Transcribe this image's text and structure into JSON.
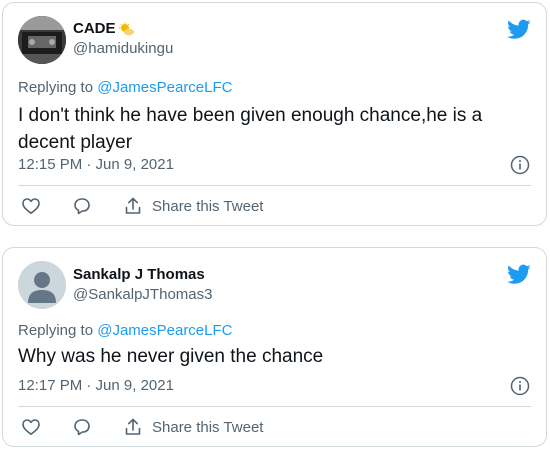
{
  "tweets": [
    {
      "display_name": "CADE",
      "name_emoji": "sun-behind-cloud-icon",
      "handle": "@hamidukingu",
      "reply_prefix": "Replying to ",
      "reply_to": "@JamesPearceLFC",
      "text": "I don't think he have been given enough chance,he is a decent player",
      "timestamp": "12:15 PM · Jun 9, 2021",
      "share_label": "Share this Tweet",
      "avatar": "photo-avatar"
    },
    {
      "display_name": "Sankalp J Thomas",
      "handle": "@SankalpJThomas3",
      "reply_prefix": "Replying to ",
      "reply_to": "@JamesPearceLFC",
      "text": "Why was he never given the chance",
      "timestamp": "12:17 PM · Jun 9, 2021",
      "share_label": "Share this Tweet",
      "avatar": "default-avatar"
    }
  ],
  "colors": {
    "twitter_blue": "#1d9bf0",
    "secondary_text": "#536471",
    "border": "#cfd9de"
  }
}
